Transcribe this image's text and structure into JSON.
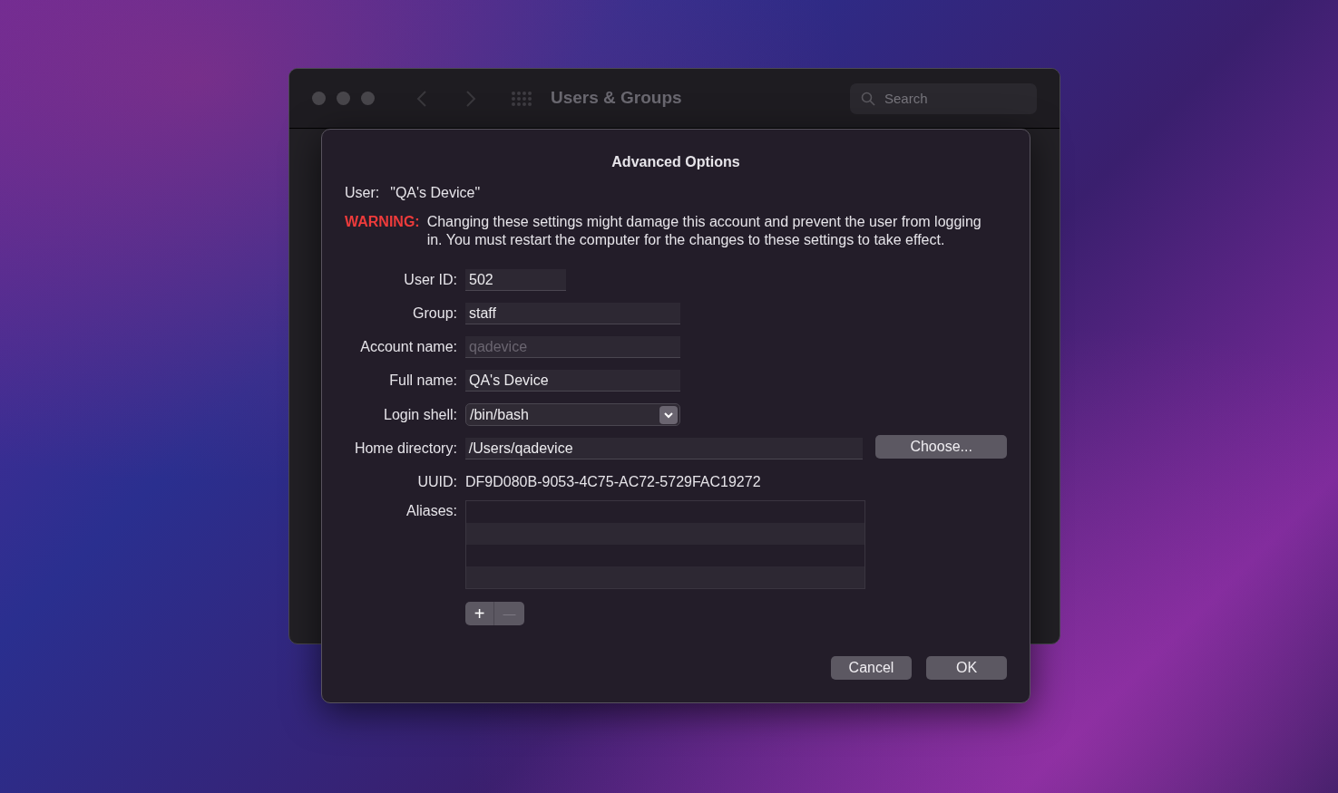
{
  "window": {
    "title": "Users & Groups",
    "search": {
      "placeholder": "Search"
    }
  },
  "sheet": {
    "title": "Advanced Options",
    "user_label": "User:",
    "user_value": "\"QA's Device\"",
    "warning_label": "WARNING:",
    "warning_text": "Changing these settings might damage this account and prevent the user from logging in. You must restart the computer for the changes to these settings to take effect.",
    "fields": [
      {
        "label": "User ID:",
        "value": "502",
        "kind": "text",
        "disabled": false
      },
      {
        "label": "Group:",
        "value": "staff",
        "kind": "text",
        "disabled": false
      },
      {
        "label": "Account name:",
        "value": "qadevice",
        "kind": "text",
        "disabled": true
      },
      {
        "label": "Full name:",
        "value": "QA's Device",
        "kind": "text",
        "disabled": false
      },
      {
        "label": "Login shell:",
        "value": "/bin/bash",
        "kind": "popup",
        "disabled": false
      },
      {
        "label": "Home directory:",
        "value": "/Users/qadevice",
        "kind": "text",
        "disabled": false,
        "button": "Choose..."
      }
    ],
    "uuid_label": "UUID:",
    "uuid_value": "DF9D080B-9053-4C75-AC72-5729FAC19272",
    "aliases_label": "Aliases:",
    "add_button": {
      "label": "+",
      "disabled": false
    },
    "remove_button": {
      "label": "—",
      "disabled": true
    },
    "buttons": [
      "Cancel",
      "OK"
    ]
  }
}
